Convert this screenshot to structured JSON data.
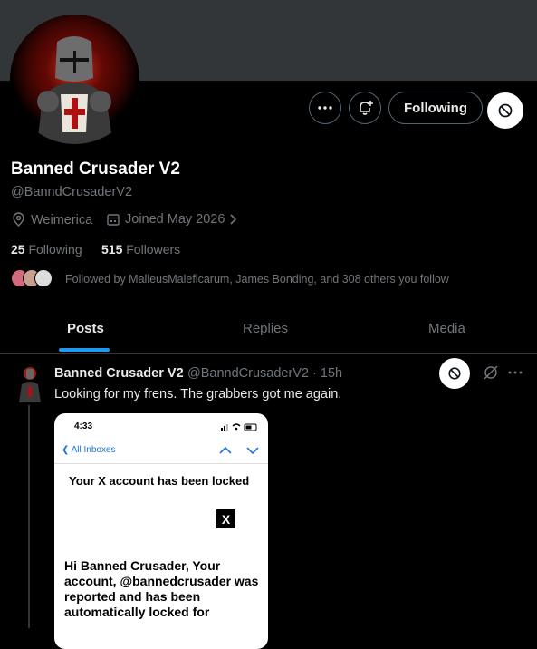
{
  "profile": {
    "name": "Banned Crusader V2",
    "handle": "@BanndCrusaderV2",
    "location": "Weimerica",
    "joined": "Joined May 2026",
    "following_count": "25",
    "following_label": "Following",
    "followers_count": "515",
    "followers_label": "Followers",
    "followed_by": "Followed by MalleusMaleficarum, James Bonding, and 308 others you follow"
  },
  "actions": {
    "following_button": "Following"
  },
  "tabs": [
    {
      "label": "Posts"
    },
    {
      "label": "Replies"
    },
    {
      "label": "Media"
    }
  ],
  "post": {
    "author": "Banned Crusader V2",
    "handle_time": "@BanndCrusaderV2 · 15h",
    "text": "Looking for my frens. The grabbers got me again."
  },
  "screenshot": {
    "time": "4:33",
    "back_label": "All Inboxes",
    "subject": "Your X account has been locked",
    "x_logo": "X",
    "body": "Hi Banned Crusader, Your account, @bannedcrusader was reported and has been automatically locked for"
  },
  "colors": {
    "accent": "#1d9bf0",
    "muted": "#71767b",
    "border": "#2f3336",
    "banner": "#333639"
  },
  "icons": [
    "more-icon",
    "notification-bell-icon",
    "block-icon",
    "location-icon",
    "calendar-icon",
    "chevron-right-icon",
    "grok-icon",
    "post-more-icon"
  ]
}
